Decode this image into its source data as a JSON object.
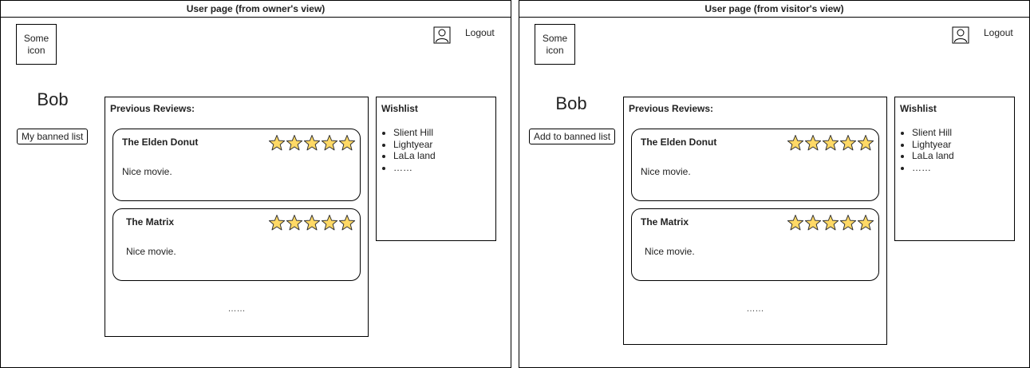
{
  "owner_view": {
    "title": "User page (from owner's view)",
    "logo_text": "Some\nicon",
    "logout_label": "Logout",
    "username": "Bob",
    "ban_button_label": "My banned list",
    "reviews_heading": "Previous Reviews:",
    "reviews": [
      {
        "title": "The Elden Donut",
        "text": "Nice movie.",
        "rating": 5
      },
      {
        "title": "The Matrix",
        "text": "Nice movie.",
        "rating": 5
      }
    ],
    "more_indicator": "……",
    "wishlist_heading": "Wishlist",
    "wishlist_items": [
      "Slient Hill",
      "Lightyear",
      "LaLa land",
      "……"
    ]
  },
  "visitor_view": {
    "title": "User page (from visitor's view)",
    "logo_text": "Some\nicon",
    "logout_label": "Logout",
    "username": "Bob",
    "ban_button_label": "Add to banned list",
    "reviews_heading": "Previous Reviews:",
    "reviews": [
      {
        "title": "The Elden Donut",
        "text": "Nice movie.",
        "rating": 5
      },
      {
        "title": "The Matrix",
        "text": "Nice movie.",
        "rating": 5
      }
    ],
    "more_indicator": "……",
    "wishlist_heading": "Wishlist",
    "wishlist_items": [
      "Slient Hill",
      "Lightyear",
      "LaLa land",
      "……"
    ]
  },
  "colors": {
    "star_fill": "#FFD966",
    "star_stroke": "#333333",
    "border": "#000000"
  },
  "icons": {
    "user": "user-icon",
    "star": "star-icon"
  }
}
